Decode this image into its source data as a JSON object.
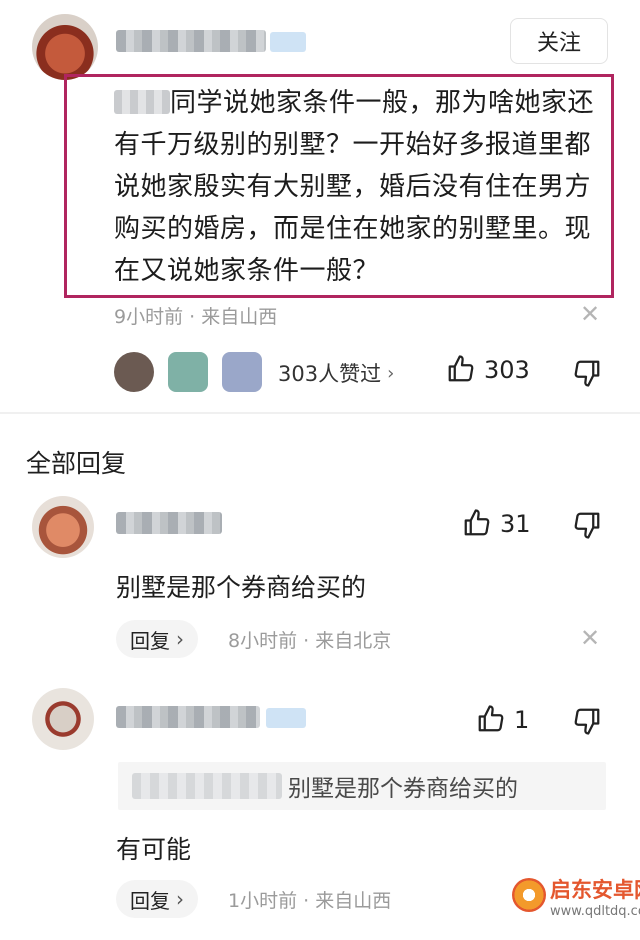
{
  "main_comment": {
    "follow_label": "关注",
    "text": "同学说她家条件一般，那为啥她家还有千万级别的别墅？一开始好多报道里都说她家殷实有大别墅，婚后没有住在男方购买的婚房，而是住在她家的别墅里。现在又说她家条件一般？",
    "meta": "9小时前 · 来自山西",
    "likers_label": "303人赞过",
    "like_count": "303"
  },
  "section_title": "全部回复",
  "replies": [
    {
      "like_count": "31",
      "text": "别墅是那个券商给买的",
      "reply_label": "回复",
      "meta": "8小时前 · 来自北京"
    },
    {
      "like_count": "1",
      "quote_text": "别墅是那个券商给买的",
      "text": "有可能",
      "reply_label": "回复",
      "meta": "1小时前 · 来自山西"
    }
  ],
  "watermark": {
    "title": "启东安卓网",
    "url": "www.qdltdq.com"
  },
  "icons": {
    "like": "thumbs-up-icon",
    "dislike": "thumbs-down-icon",
    "close": "close-icon",
    "chevron": "chevron-right-icon"
  }
}
